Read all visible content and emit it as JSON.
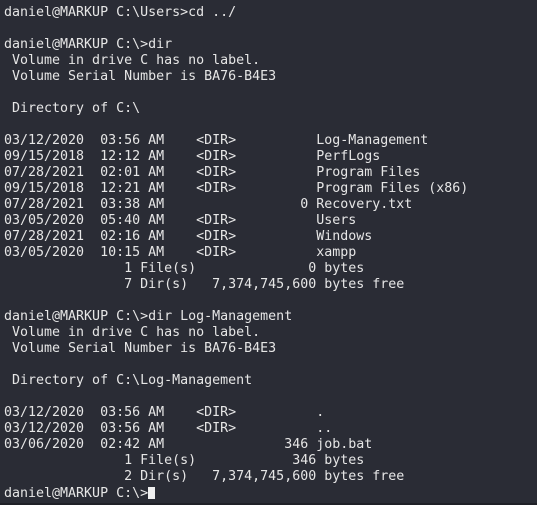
{
  "terminal": {
    "lines": [
      "daniel@MARKUP C:\\Users>cd ../",
      "",
      "daniel@MARKUP C:\\>dir",
      " Volume in drive C has no label.",
      " Volume Serial Number is BA76-B4E3",
      "",
      " Directory of C:\\",
      "",
      "03/12/2020  03:56 AM    <DIR>          Log-Management",
      "09/15/2018  12:12 AM    <DIR>          PerfLogs",
      "07/28/2021  02:01 AM    <DIR>          Program Files",
      "09/15/2018  12:21 AM    <DIR>          Program Files (x86)",
      "07/28/2021  03:38 AM                 0 Recovery.txt",
      "03/05/2020  05:40 AM    <DIR>          Users",
      "07/28/2021  02:16 AM    <DIR>          Windows",
      "03/05/2020  10:15 AM    <DIR>          xampp",
      "               1 File(s)              0 bytes",
      "               7 Dir(s)   7,374,745,600 bytes free",
      "",
      "daniel@MARKUP C:\\>dir Log-Management",
      " Volume in drive C has no label.",
      " Volume Serial Number is BA76-B4E3",
      "",
      " Directory of C:\\Log-Management",
      "",
      "03/12/2020  03:56 AM    <DIR>          .",
      "03/12/2020  03:56 AM    <DIR>          ..",
      "03/06/2020  02:42 AM               346 job.bat",
      "               1 File(s)            346 bytes",
      "               2 Dir(s)   7,374,745,600 bytes free"
    ],
    "current_prompt": "daniel@MARKUP C:\\>"
  }
}
